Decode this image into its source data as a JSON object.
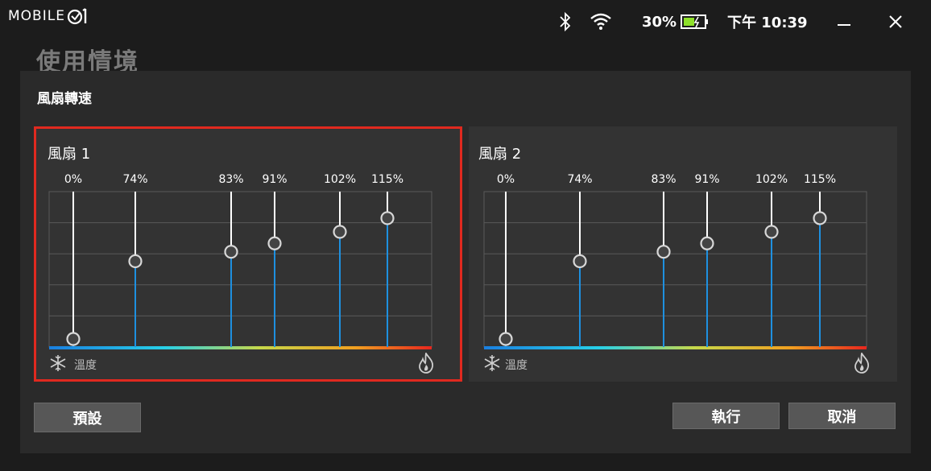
{
  "logo": {
    "text": "MOBILE"
  },
  "status": {
    "battery_percent": "30%",
    "time": "下午 10:39"
  },
  "page_title": "使用情境",
  "dialog": {
    "title": "風扇轉速",
    "fans": [
      {
        "title": "風扇 1",
        "selected": true,
        "temperature_label": "溫度",
        "points": [
          {
            "label": "0%",
            "value": 0
          },
          {
            "label": "74%",
            "value": 74
          },
          {
            "label": "83%",
            "value": 83
          },
          {
            "label": "91%",
            "value": 91
          },
          {
            "label": "102%",
            "value": 102
          },
          {
            "label": "115%",
            "value": 115
          }
        ]
      },
      {
        "title": "風扇 2",
        "selected": false,
        "temperature_label": "溫度",
        "points": [
          {
            "label": "0%",
            "value": 0
          },
          {
            "label": "74%",
            "value": 74
          },
          {
            "label": "83%",
            "value": 83
          },
          {
            "label": "91%",
            "value": 91
          },
          {
            "label": "102%",
            "value": 102
          },
          {
            "label": "115%",
            "value": 115
          }
        ]
      }
    ],
    "buttons": {
      "default": "預設",
      "run": "執行",
      "cancel": "取消"
    }
  },
  "colors": {
    "accent_red": "#e0291f",
    "line_blue": "#1e90e0",
    "handle_fill": "#444444"
  },
  "icons": [
    "bluetooth-icon",
    "wifi-icon",
    "battery-charging-icon",
    "minimize-icon",
    "close-icon",
    "snowflake-icon",
    "flame-icon"
  ]
}
